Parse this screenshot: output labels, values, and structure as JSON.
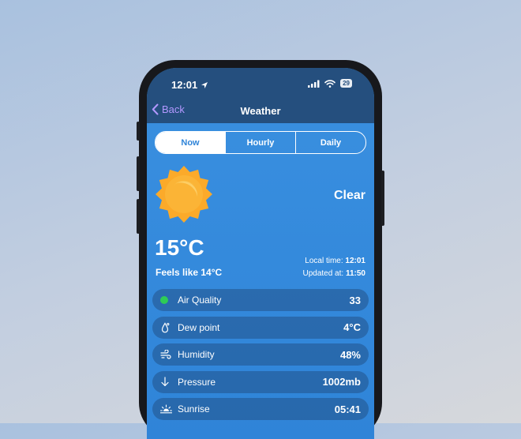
{
  "status": {
    "time": "12:01",
    "battery": "29"
  },
  "nav": {
    "back_label": "Back",
    "title": "Weather"
  },
  "tabs": [
    {
      "label": "Now",
      "active": true
    },
    {
      "label": "Hourly",
      "active": false
    },
    {
      "label": "Daily",
      "active": false
    }
  ],
  "current": {
    "icon": "sun-icon",
    "condition": "Clear",
    "temperature": "15°C",
    "feels_like": "Feels like 14°C",
    "local_time_label": "Local time:",
    "local_time": "12:01",
    "updated_label": "Updated at:",
    "updated_time": "11:50"
  },
  "details": [
    {
      "icon": "air-quality-dot-icon",
      "label": "Air Quality",
      "value": "33"
    },
    {
      "icon": "droplet-icon",
      "label": "Dew point",
      "value": "4°C"
    },
    {
      "icon": "humidity-icon",
      "label": "Humidity",
      "value": "48%"
    },
    {
      "icon": "arrow-down-icon",
      "label": "Pressure",
      "value": "1002mb"
    },
    {
      "icon": "sunrise-icon",
      "label": "Sunrise",
      "value": "05:41"
    }
  ],
  "colors": {
    "accent": "#2f84d8",
    "back": "#b398ff",
    "sun": "#fbaa2a",
    "air_good": "#2ecc56"
  }
}
